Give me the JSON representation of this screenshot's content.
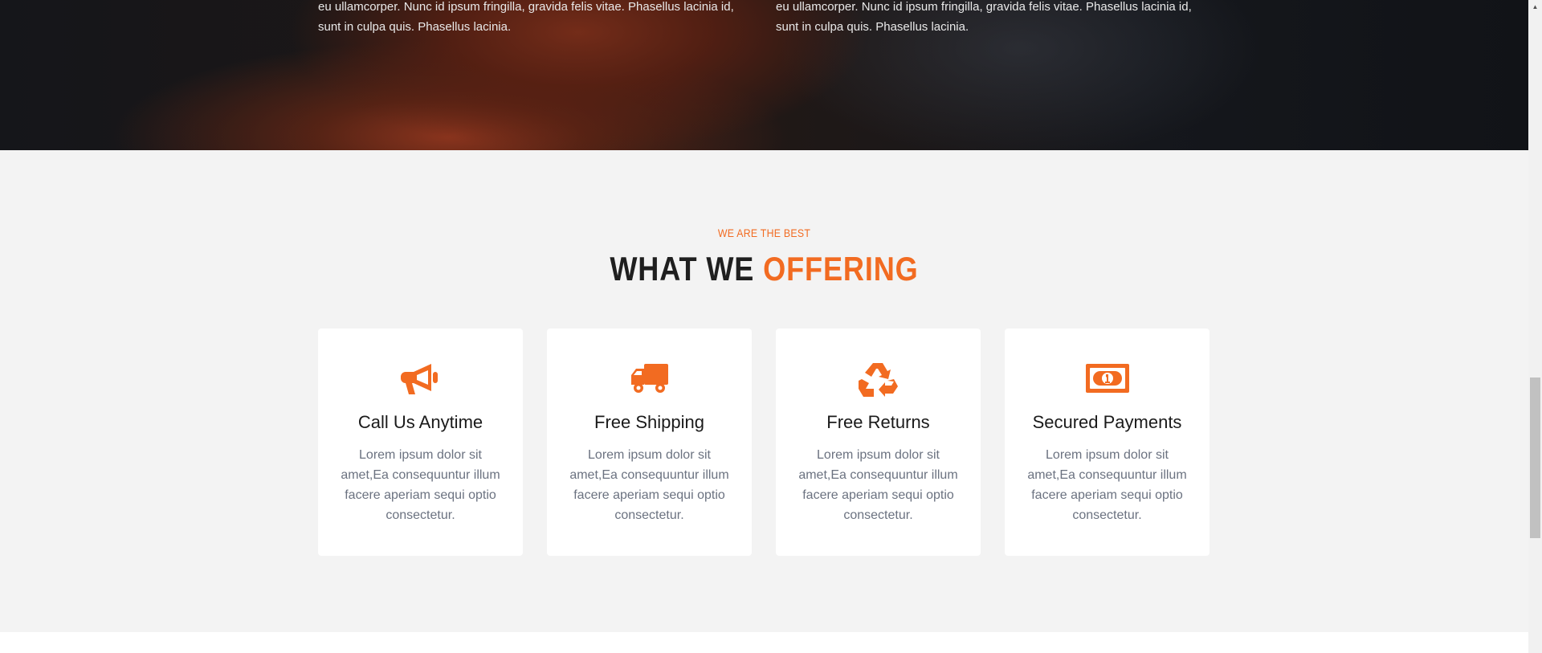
{
  "hero": {
    "left_text": "eu ullamcorper. Nunc id ipsum fringilla, gravida felis vitae. Phasellus lacinia id, sunt in culpa quis. Phasellus lacinia.",
    "right_text": "eu ullamcorper. Nunc id ipsum fringilla, gravida felis vitae. Phasellus lacinia id, sunt in culpa quis. Phasellus lacinia."
  },
  "section": {
    "eyebrow": "WE ARE THE BEST",
    "heading_part1": "WHAT WE ",
    "heading_part2": "OFFERING"
  },
  "cards": [
    {
      "icon": "megaphone-icon",
      "title": "Call Us Anytime",
      "desc": "Lorem ipsum dolor sit amet,Ea consequuntur illum facere aperiam sequi optio consectetur."
    },
    {
      "icon": "truck-icon",
      "title": "Free Shipping",
      "desc": "Lorem ipsum dolor sit amet,Ea consequuntur illum facere aperiam sequi optio consectetur."
    },
    {
      "icon": "recycle-icon",
      "title": "Free Returns",
      "desc": "Lorem ipsum dolor sit amet,Ea consequuntur illum facere aperiam sequi optio consectetur."
    },
    {
      "icon": "money-bill-icon",
      "title": "Secured Payments",
      "desc": "Lorem ipsum dolor sit amet,Ea consequuntur illum facere aperiam sequi optio consectetur."
    }
  ],
  "colors": {
    "accent": "#f26b21",
    "heading": "#1f1f1f",
    "section_bg": "#f3f3f3",
    "card_bg": "#ffffff",
    "body_text": "#6b7280"
  }
}
